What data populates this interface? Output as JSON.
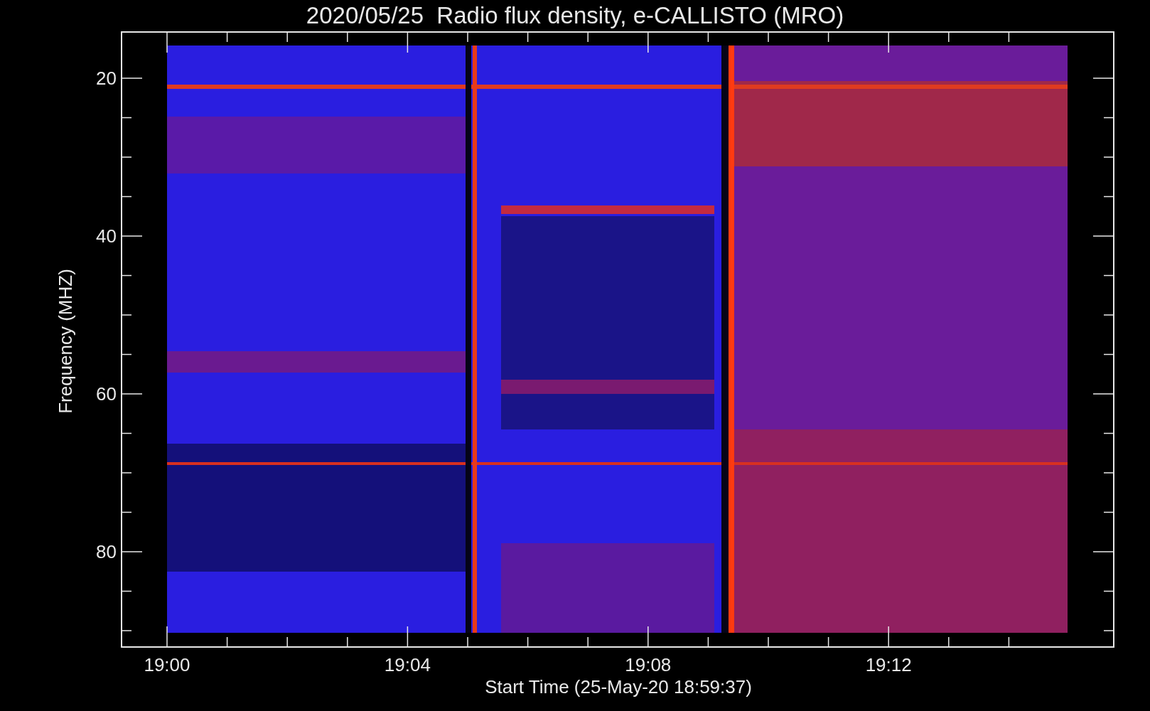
{
  "plot": {
    "title": "2020/05/25  Radio flux density, e-CALLISTO (MRO)",
    "y_label": "Frequency (MHZ)",
    "y_ticks": [
      "20",
      "40",
      "60",
      "80"
    ],
    "x_ticks": [
      "19:00",
      "19:04",
      "19:08",
      "19:12"
    ],
    "x_label": "Start Time (25-May-20 18:59:37)"
  }
}
